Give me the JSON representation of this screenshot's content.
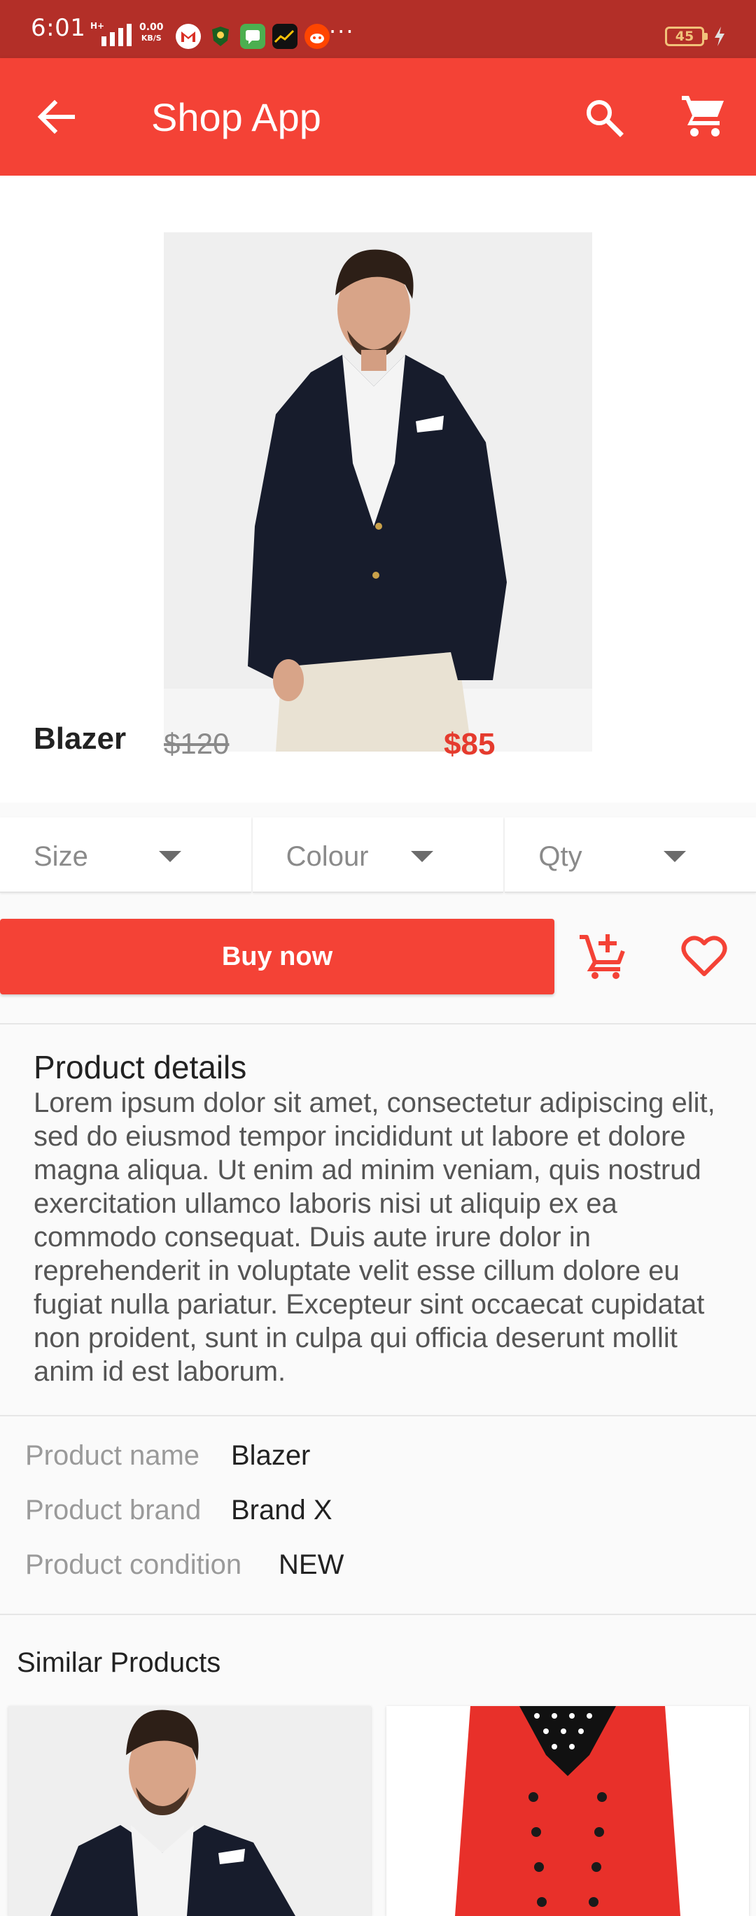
{
  "status_bar": {
    "time": "6:01",
    "net_type": "H+",
    "speed_value": "0.00",
    "speed_unit": "KB/S",
    "more": "···",
    "battery": "45"
  },
  "app_bar": {
    "title": "Shop App",
    "color": "#f44236"
  },
  "product": {
    "name": "Blazer",
    "old_price": "$120",
    "new_price": "$85"
  },
  "selectors": [
    {
      "label": "Size"
    },
    {
      "label": "Colour"
    },
    {
      "label": "Qty"
    }
  ],
  "actions": {
    "buy_label": "Buy now",
    "add_to_cart_icon": "add-shopping-cart-icon",
    "favorite_icon": "heart-outline-icon"
  },
  "details": {
    "title": "Product details",
    "body": "Lorem ipsum dolor sit amet, consectetur adipiscing elit, sed do eiusmod tempor incididunt ut labore et dolore magna aliqua. Ut enim ad minim veniam, quis nostrud exercitation ullamco laboris nisi ut aliquip ex ea commodo consequat. Duis aute irure dolor in reprehenderit in voluptate velit esse cillum dolore eu fugiat nulla pariatur. Excepteur sint occaecat cupidatat non proident, sunt in culpa qui officia deserunt mollit anim id est laborum."
  },
  "specs": [
    {
      "key": "Product name",
      "value": "Blazer"
    },
    {
      "key": "Product brand",
      "value": "Brand X"
    },
    {
      "key": "Product condition",
      "value": "NEW"
    }
  ],
  "similar": {
    "title": "Similar Products"
  }
}
